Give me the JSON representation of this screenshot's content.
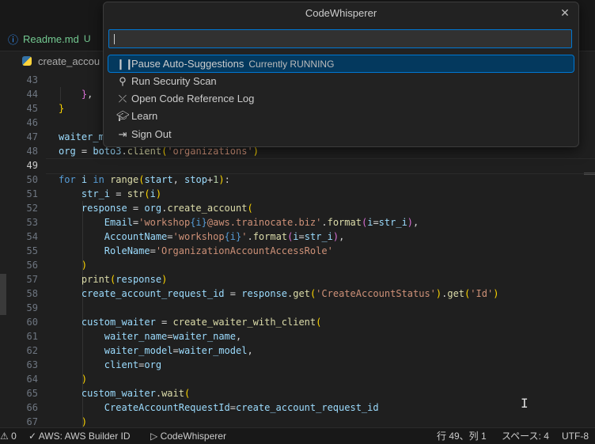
{
  "tabs": {
    "readme_label": "Readme.md",
    "readme_status": "U"
  },
  "breadcrumb": {
    "file_label": "create_accou"
  },
  "palette": {
    "title": "CodeWhisperer",
    "input_value": "",
    "items": [
      {
        "icon": "pause-icon",
        "label": "Pause Auto-Suggestions",
        "description": "Currently RUNNING",
        "selected": true
      },
      {
        "icon": "security-scan-icon",
        "label": "Run Security Scan",
        "description": ""
      },
      {
        "icon": "reference-log-icon",
        "label": "Open Code Reference Log",
        "description": ""
      },
      {
        "icon": "learn-icon",
        "label": "Learn",
        "description": ""
      },
      {
        "icon": "sign-out-icon",
        "label": "Sign Out",
        "description": ""
      }
    ]
  },
  "editor": {
    "line_numbers": [
      "43",
      "44",
      "45",
      "46",
      "47",
      "48",
      "49",
      "50",
      "51",
      "52",
      "53",
      "54",
      "55",
      "56",
      "57",
      "58",
      "59",
      "60",
      "61",
      "62",
      "63",
      "64",
      "65",
      "66",
      "67"
    ],
    "active_line": "49"
  },
  "statusbar": {
    "problems_count": "0",
    "aws_label": "AWS: AWS Builder ID",
    "codewhisperer_label": "CodeWhisperer",
    "position": "行 49、列 1",
    "spaces": "スペース: 4",
    "encoding": "UTF-8"
  }
}
